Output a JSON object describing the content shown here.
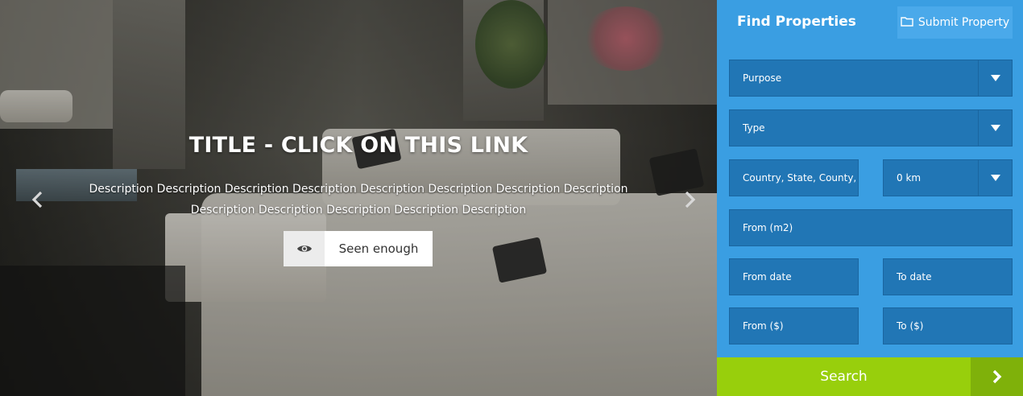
{
  "hero": {
    "title": "TITLE - CLICK ON THIS LINK",
    "description": "Description Description Description Description Description Description Description Description Description Description Description Description Description",
    "seen_button_label": "Seen enough"
  },
  "sidebar": {
    "title": "Find Properties",
    "submit_label": "Submit Property",
    "fields": {
      "purpose": "Purpose",
      "type": "Type",
      "location": "Country, State, County,",
      "radius": "0 km",
      "from_area": "From (m2)",
      "from_date": "From date",
      "to_date": "To date",
      "from_price": "From ($)",
      "to_price": "To ($)"
    },
    "search_label": "Search"
  },
  "colors": {
    "sidebar_bg": "#3a9ee2",
    "field_bg": "#2176b5",
    "search_green": "#98cf0c",
    "search_arrow_green": "#7fb10a"
  }
}
